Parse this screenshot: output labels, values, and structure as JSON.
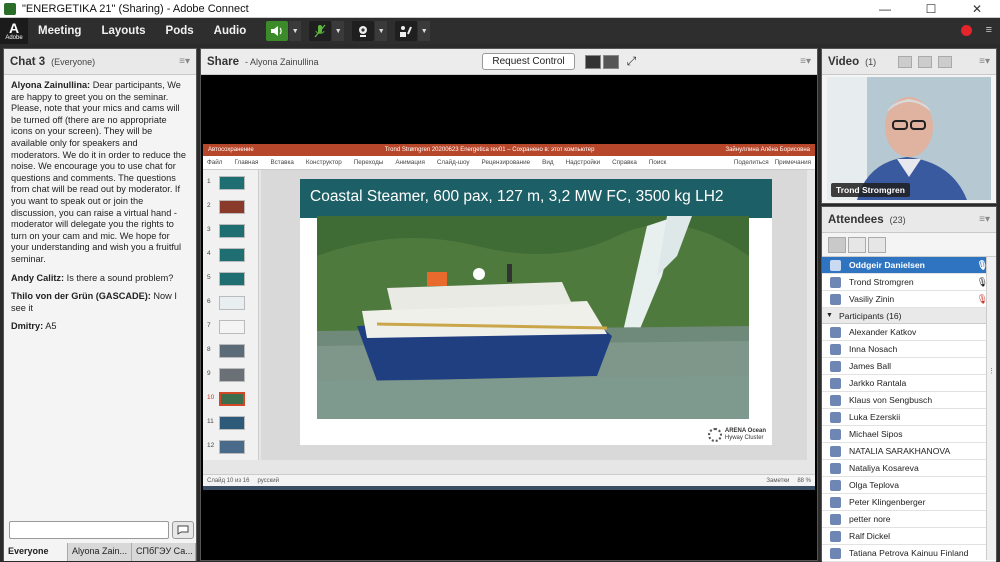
{
  "window": {
    "title": "\"ENERGETIKA 21\" (Sharing) - Adobe Connect",
    "minimize": "—",
    "maximize": "☐",
    "close": "✕"
  },
  "menubar": {
    "logo_letter": "A",
    "logo_text": "Adobe",
    "items": [
      "Meeting",
      "Layouts",
      "Pods",
      "Audio"
    ],
    "record_color": "#e5242b"
  },
  "chat": {
    "title": "Chat 3",
    "audience": "(Everyone)",
    "messages": [
      {
        "sender": "Alyona Zainullina:",
        "text": "Dear participants, We are happy to greet you on the seminar. Please, note that your mics and cams will be turned off (there are no appropriate icons on your screen). They will be available only for speakers and moderators. We do it in order to reduce the noise. We encourage you to use chat for questions and comments. The questions from chat will be read out by moderator. If you want to speak out or join the discussion, you can raise a virtual hand - moderator will delegate you the rights to turn on your cam and mic. We hope for your understanding and wish you a fruitful seminar."
      },
      {
        "sender": "Andy Calitz:",
        "text": "Is there a sound problem?"
      },
      {
        "sender": "Thilo von der Grün (GASCADE):",
        "text": "Now I see it"
      },
      {
        "sender": "Dmitry:",
        "text": "A5"
      }
    ],
    "tabs": [
      "Everyone",
      "Alyona Zain...",
      "СПбГЭУ Са..."
    ]
  },
  "share": {
    "title": "Share",
    "presenter": "- Alyona Zainullina",
    "request_control": "Request Control",
    "ppt": {
      "titlebar_left": "Автосохранение",
      "titlebar_center": "Trond Strømgren 20200623 Energetica rev01 – Сохранено в: этот компьютер",
      "titlebar_right": "Зайнуллина Алёна Борисовна",
      "ribbon": [
        "Файл",
        "Главная",
        "Вставка",
        "Конструктор",
        "Переходы",
        "Анимация",
        "Слайд-шоу",
        "Рецензирование",
        "Вид",
        "Надстройки",
        "Справка",
        "Поиск"
      ],
      "ribbon_right": [
        "Поделиться",
        "Примечания"
      ],
      "slide_numbers": [
        "1",
        "2",
        "3",
        "4",
        "5",
        "6",
        "7",
        "8",
        "9",
        "10",
        "11",
        "12"
      ],
      "slide_title": "Coastal Steamer, 600 pax, 127 m, 3,2 MW FC, 3500 kg LH2",
      "logo_line1": "ARENA Ocean",
      "logo_line2": "Hyway Cluster",
      "status_left": "Слайд 10 из 16",
      "status_lang": "русский",
      "status_notes": "Заметки",
      "status_zoom": "88 %"
    }
  },
  "video": {
    "title": "Video",
    "count": "(1)",
    "speaker": "Trond Stromgren"
  },
  "attendees": {
    "title": "Attendees",
    "count": "(23)",
    "hosts": [
      {
        "name": "Oddgeir Danielsen",
        "selected": true
      },
      {
        "name": "Trond Stromgren",
        "selected": false
      },
      {
        "name": "Vasiliy Zinin",
        "selected": false
      }
    ],
    "participants_label": "Participants (16)",
    "participants": [
      "Alexander Katkov",
      "Inna Nosach",
      "James Ball",
      "Jarkko Rantala",
      "Klaus von Sengbusch",
      "Luka Ezerskii",
      "Michael Sipos",
      "NATALIA SARAKHANOVA",
      "Nataliya Kosareva",
      "Olga Teplova",
      "Peter Klingenberger",
      "petter nore",
      "Ralf Dickel",
      "Tatiana Petrova Kainuu Finland"
    ]
  }
}
